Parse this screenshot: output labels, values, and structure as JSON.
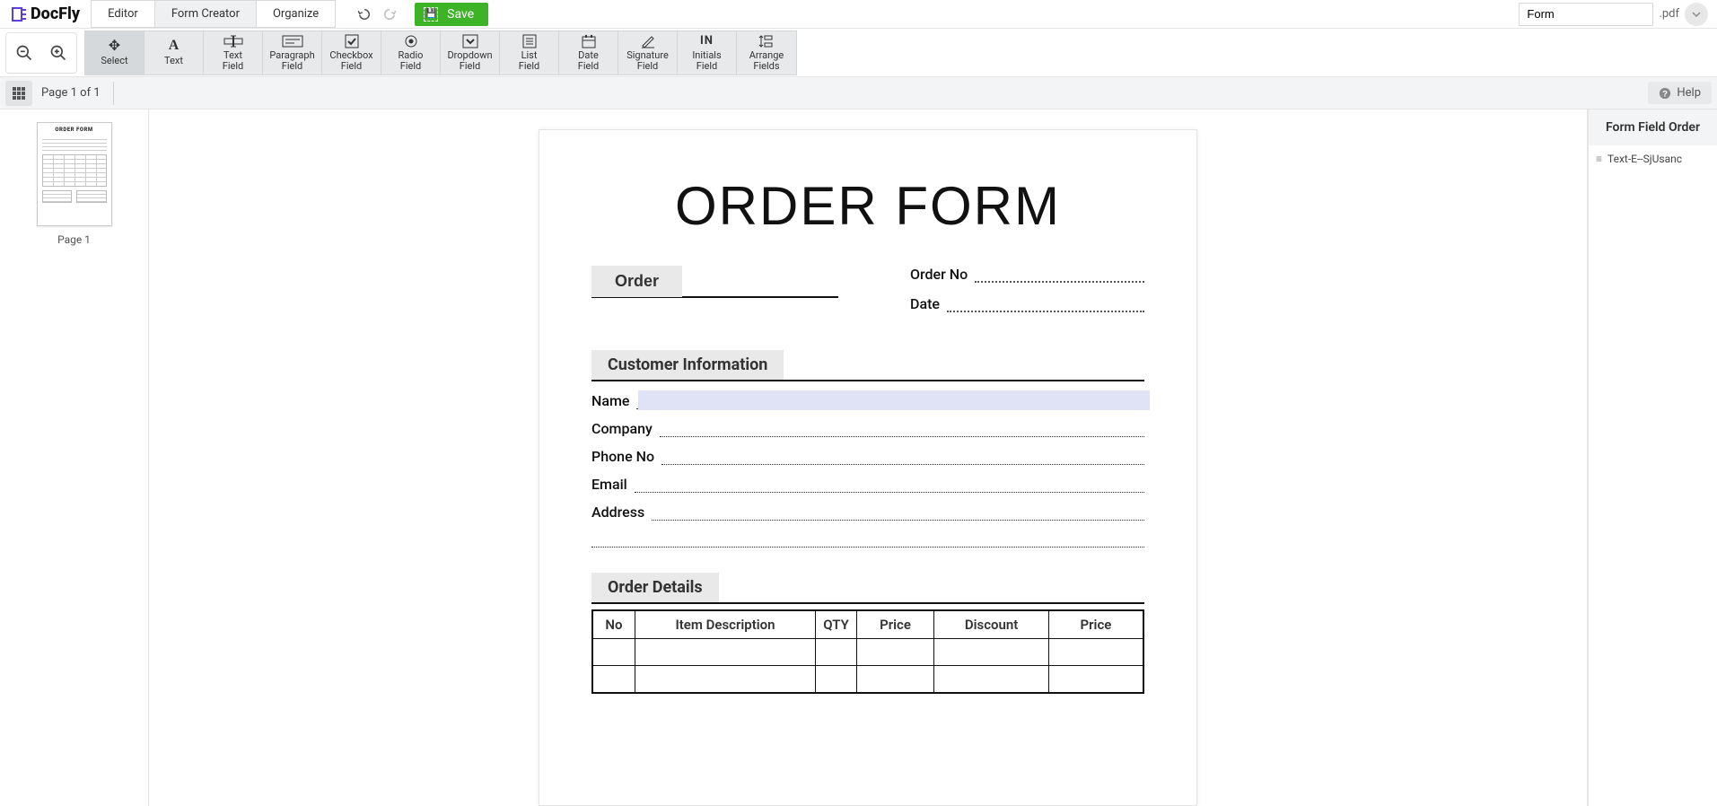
{
  "brand": "DocFly",
  "tabs": {
    "editor": "Editor",
    "form_creator": "Form Creator",
    "organize": "Organize"
  },
  "save_label": "Save",
  "filename": "Form",
  "file_ext": ".pdf",
  "tools": {
    "select": "Select",
    "text": "Text",
    "text_field": "Text\nField",
    "paragraph_field": "Paragraph\nField",
    "checkbox_field": "Checkbox\nField",
    "radio_field": "Radio\nField",
    "dropdown_field": "Dropdown\nField",
    "list_field": "List\nField",
    "date_field": "Date\nField",
    "signature_field": "Signature\nField",
    "initials_field": "Initials\nField",
    "arrange_fields": "Arrange\nFields"
  },
  "page_indicator": "Page 1 of 1",
  "help_label": "Help",
  "thumb": {
    "title": "ORDER FORM",
    "caption": "Page 1"
  },
  "document": {
    "title": "ORDER FORM",
    "order_tab": "Order",
    "meta": {
      "order_no": "Order No",
      "date": "Date"
    },
    "customer_section": "Customer Information",
    "fields": {
      "name": "Name",
      "company": "Company",
      "phone": "Phone No",
      "email": "Email",
      "address": "Address"
    },
    "order_details_section": "Order Details",
    "table_headers": {
      "no": "No",
      "item_desc": "Item Description",
      "qty": "QTY",
      "price": "Price",
      "discount": "Discount",
      "price2": "Price"
    }
  },
  "right_panel": {
    "title": "Form Field Order",
    "item1": "Text-E--SjUsanc"
  }
}
